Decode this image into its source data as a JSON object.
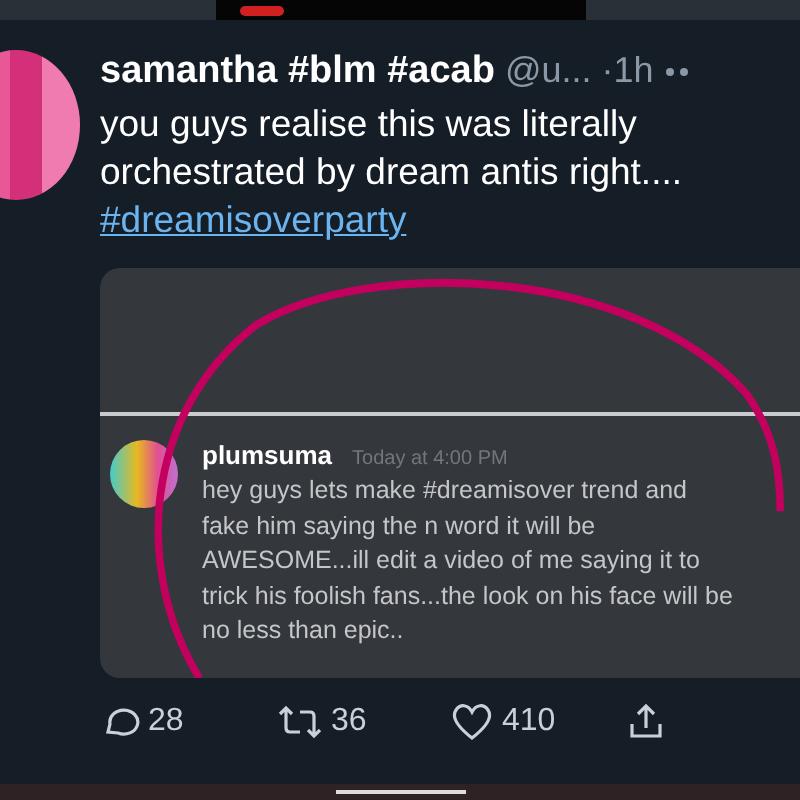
{
  "tweet": {
    "display_name": "samantha #blm #acab",
    "handle": "@u...",
    "time": "·1h",
    "text": "you guys realise this was literally orchestrated by dream antis right....",
    "hashtag": "#dreamisoverparty",
    "embed": {
      "author": "plumsuma",
      "timestamp": "Today at 4:00 PM",
      "message": "hey guys lets make #dreamisover trend and fake him saying the n word it will be AWESOME...ill edit a video of me saying it to trick his foolish fans...the look on his face will be no less than epic.."
    },
    "actions": [
      {
        "kind": "reply",
        "count": "28"
      },
      {
        "kind": "retweet",
        "count": "36"
      },
      {
        "kind": "like",
        "count": "410"
      },
      {
        "kind": "share"
      }
    ]
  }
}
